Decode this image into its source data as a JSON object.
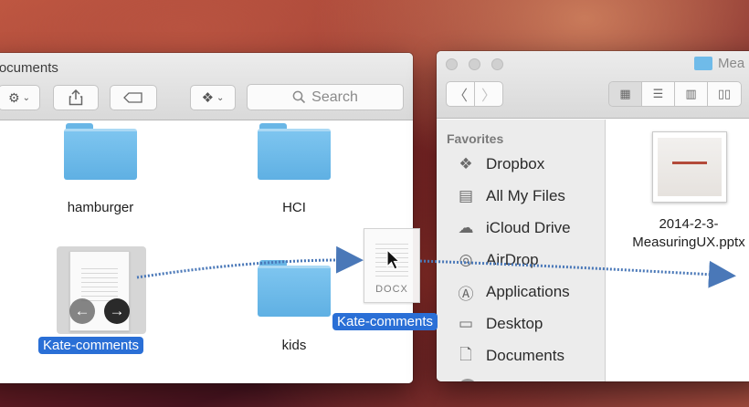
{
  "left_window": {
    "title": "Documents",
    "search_placeholder": "Search",
    "items": [
      {
        "name": "hamburger",
        "type": "folder"
      },
      {
        "name": "HCI",
        "type": "folder"
      },
      {
        "name": "Kate-comments",
        "type": "docx",
        "selected": true
      },
      {
        "name": "kids",
        "type": "folder"
      }
    ],
    "doc_ext": "DOCX"
  },
  "right_window": {
    "title": "Mea",
    "sidebar": {
      "heading": "Favorites",
      "items": [
        {
          "label": "Dropbox",
          "icon": "dropbox-icon"
        },
        {
          "label": "All My Files",
          "icon": "all-my-files-icon"
        },
        {
          "label": "iCloud Drive",
          "icon": "cloud-icon"
        },
        {
          "label": "AirDrop",
          "icon": "airdrop-icon"
        },
        {
          "label": "Applications",
          "icon": "applications-icon"
        },
        {
          "label": "Desktop",
          "icon": "desktop-icon"
        },
        {
          "label": "Documents",
          "icon": "documents-icon"
        }
      ]
    },
    "files": [
      {
        "name_line1": "2014-2-3-",
        "name_line2": "MeasuringUX.pptx"
      }
    ]
  },
  "drag": {
    "label": "Kate-comments",
    "ext": "DOCX"
  },
  "colors": {
    "selection": "#2a6fd6",
    "folder": "#69b6e6",
    "arrow": "#4a78b8"
  }
}
